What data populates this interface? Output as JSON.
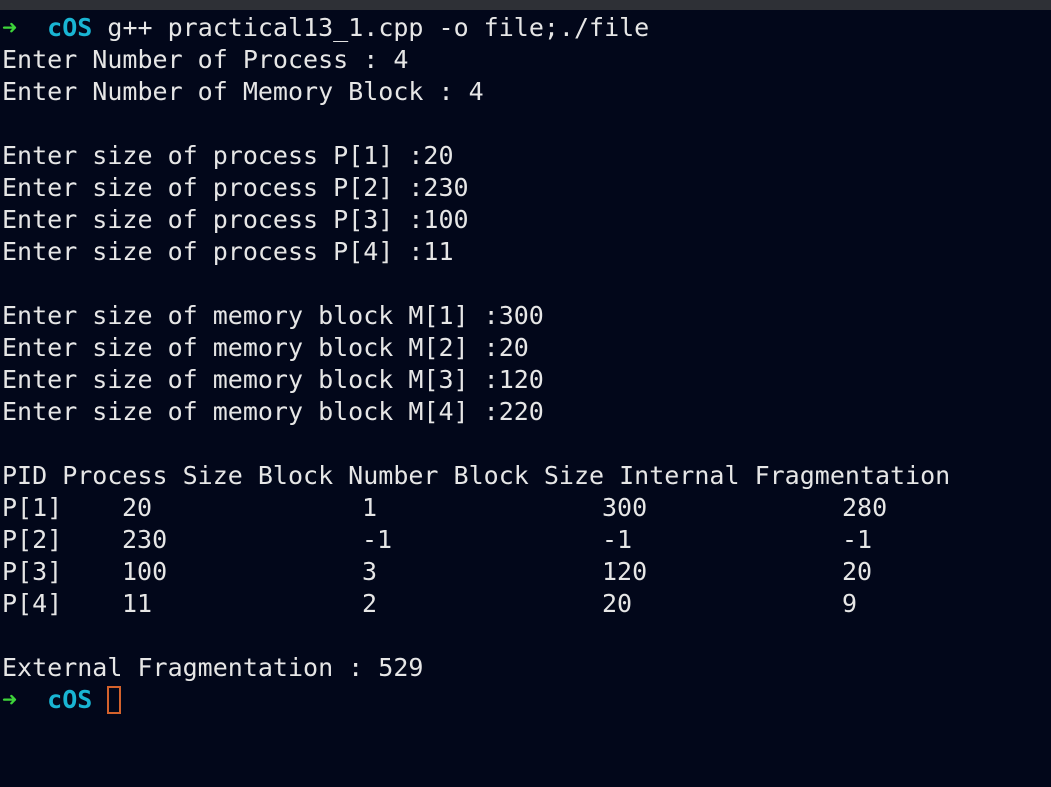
{
  "prompt": {
    "arrow": "➜",
    "dir": "cOS",
    "command": "g++ practical13_1.cpp -o file;./file"
  },
  "input": {
    "process_count_line": "Enter Number of Process : 4",
    "block_count_line": "Enter Number of Memory Block : 4",
    "process_sizes": [
      "Enter size of process P[1] :20",
      "Enter size of process P[2] :230",
      "Enter size of process P[3] :100",
      "Enter size of process P[4] :11"
    ],
    "block_sizes": [
      "Enter size of memory block M[1] :300",
      "Enter size of memory block M[2] :20",
      "Enter size of memory block M[3] :120",
      "Enter size of memory block M[4] :220"
    ]
  },
  "table": {
    "header": "PID Process Size Block Number Block Size Internal Fragmentation",
    "rows": [
      {
        "pid": "P[1]",
        "size": "20",
        "block": "1",
        "block_size": "300",
        "internal": "280"
      },
      {
        "pid": "P[2]",
        "size": "230",
        "block": "-1",
        "block_size": "-1",
        "internal": "-1"
      },
      {
        "pid": "P[3]",
        "size": "100",
        "block": "3",
        "block_size": "120",
        "internal": "20"
      },
      {
        "pid": "P[4]",
        "size": "11",
        "block": "2",
        "block_size": "20",
        "internal": "9"
      }
    ]
  },
  "result": {
    "external_line": "External Fragmentation : 529"
  },
  "colors": {
    "background": "#02071a",
    "text": "#e6e6e6",
    "arrow": "#3ed43a",
    "dir": "#19b5d3",
    "cursor": "#d4622c"
  }
}
